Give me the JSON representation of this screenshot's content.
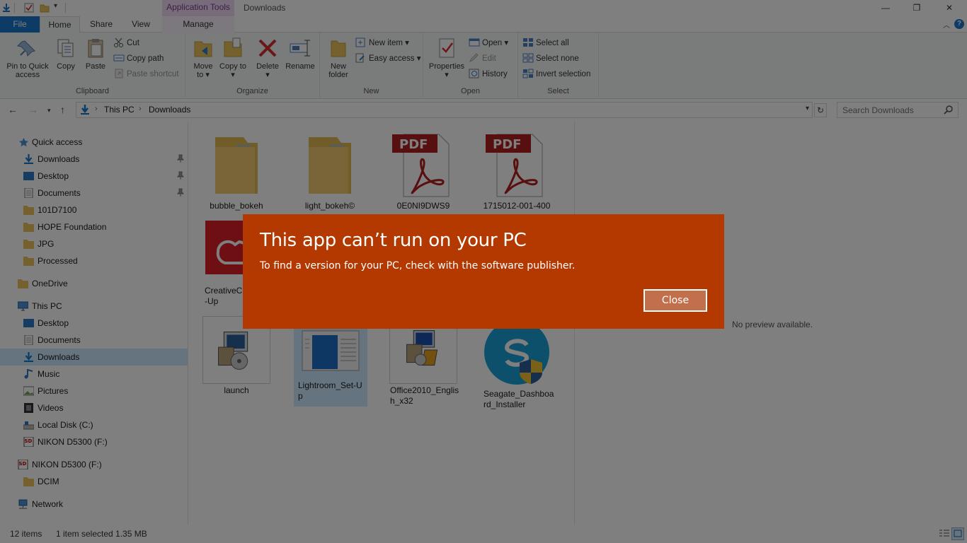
{
  "window": {
    "title": "Downloads",
    "context_tab": "Application Tools",
    "minimize": "—",
    "maximize": "❐",
    "close": "✕"
  },
  "ribbon_tabs": {
    "file": "File",
    "home": "Home",
    "share": "Share",
    "view": "View",
    "manage": "Manage"
  },
  "ribbon": {
    "clipboard": {
      "label": "Clipboard",
      "pin": "Pin to Quick access",
      "copy": "Copy",
      "paste": "Paste",
      "cut": "Cut",
      "copy_path": "Copy path",
      "paste_shortcut": "Paste shortcut"
    },
    "organize": {
      "label": "Organize",
      "move_to": "Move to",
      "copy_to": "Copy to",
      "delete": "Delete",
      "rename": "Rename"
    },
    "new": {
      "label": "New",
      "new_folder": "New folder",
      "new_item": "New item",
      "easy_access": "Easy access"
    },
    "open": {
      "label": "Open",
      "properties": "Properties",
      "open": "Open",
      "edit": "Edit",
      "history": "History"
    },
    "select": {
      "label": "Select",
      "select_all": "Select all",
      "select_none": "Select none",
      "invert": "Invert selection"
    }
  },
  "address": {
    "crumbs": [
      "This PC",
      "Downloads"
    ],
    "separator": "›",
    "search_placeholder": "Search Downloads"
  },
  "nav": {
    "quick_access": "Quick access",
    "qa_items": [
      "Downloads",
      "Desktop",
      "Documents",
      "101D7100",
      "HOPE Foundation",
      "JPG",
      "Processed"
    ],
    "onedrive": "OneDrive",
    "this_pc": "This PC",
    "pc_items": [
      "Desktop",
      "Documents",
      "Downloads",
      "Music",
      "Pictures",
      "Videos",
      "Local Disk (C:)",
      "NIKON D5300 (F:)"
    ],
    "drive_f": "NIKON D5300 (F:)",
    "dcim": "DCIM",
    "network": "Network"
  },
  "files": [
    "bubble_bokeh",
    "light_bokeh©",
    "0E0NI9DWS9",
    "1715012-001-400",
    "CreativeCloudSet-Up",
    "launch",
    "Lightroom_Set-Up",
    "Office2010_English_x32",
    "Seagate_Dashboard_Installer"
  ],
  "file_labels": {
    "creative_line1": "CreativeCl",
    "creative_line2": "-Up",
    "lightroom_line1": "Lightroom_Set-U",
    "lightroom_line2": "p",
    "office_line1": "Office2010_Englis",
    "office_line2": "h_x32",
    "seagate_line1": "Seagate_Dashboa",
    "seagate_line2": "rd_Installer"
  },
  "icon_text": {
    "pdf": "PDF"
  },
  "preview": {
    "text": "No preview available."
  },
  "status": {
    "count": "12 items",
    "selection": "1 item selected  1.35 MB"
  },
  "dialog": {
    "title": "This app can’t run on your PC",
    "message": "To find a version for your PC, check with the software publisher.",
    "close_label": "Close",
    "color": "#b33900"
  }
}
